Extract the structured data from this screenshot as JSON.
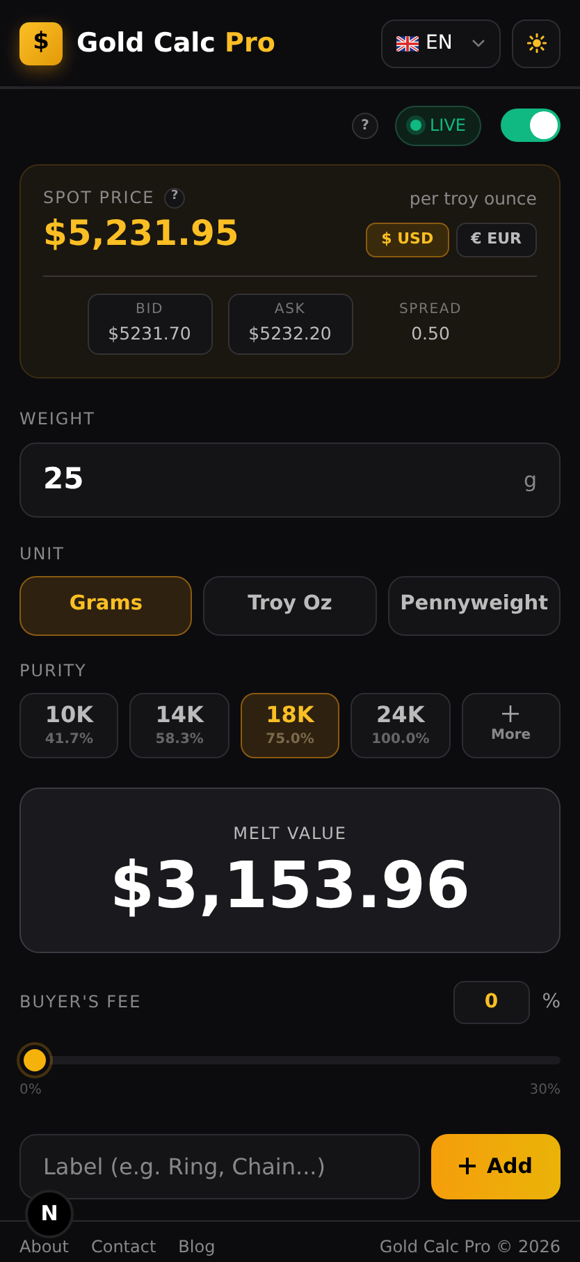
{
  "header": {
    "logo_symbol": "$",
    "title": "Gold Calc",
    "title_accent": "Pro",
    "language": "EN"
  },
  "live": {
    "help": "?",
    "label": "LIVE",
    "on": true
  },
  "spot": {
    "label": "SPOT PRICE",
    "help": "?",
    "price": "$5,231.95",
    "unit_note": "per troy ounce",
    "currencies": [
      {
        "label": "$ USD",
        "selected": true
      },
      {
        "label": "€ EUR",
        "selected": false
      }
    ],
    "quotes": [
      {
        "kind": "box",
        "label": "BID",
        "value": "$5231.70"
      },
      {
        "kind": "box",
        "label": "ASK",
        "value": "$5232.20"
      },
      {
        "kind": "plain",
        "label": "SPREAD",
        "value": "0.50"
      }
    ]
  },
  "weight": {
    "label": "WEIGHT",
    "value": "25",
    "unit": "g"
  },
  "unit": {
    "label": "UNIT",
    "options": [
      {
        "label": "Grams",
        "selected": true
      },
      {
        "label": "Troy Oz",
        "selected": false
      },
      {
        "label": "Pennyweight",
        "selected": false
      }
    ]
  },
  "purity": {
    "label": "PURITY",
    "options": [
      {
        "kind": "karat",
        "label": "10K",
        "percent": "41.7%",
        "selected": false
      },
      {
        "kind": "karat",
        "label": "14K",
        "percent": "58.3%",
        "selected": false
      },
      {
        "kind": "karat",
        "label": "18K",
        "percent": "75.0%",
        "selected": true
      },
      {
        "kind": "karat",
        "label": "24K",
        "percent": "100.0%",
        "selected": false
      },
      {
        "kind": "more",
        "label": "More",
        "selected": false
      }
    ]
  },
  "melt": {
    "label": "MELT VALUE",
    "value": "$3,153.96"
  },
  "fee": {
    "label": "BUYER'S FEE",
    "value": "0",
    "unit": "%",
    "level": 0,
    "min_label": "0%",
    "max_label": "30%"
  },
  "add": {
    "placeholder": "Label (e.g. Ring, Chain...)",
    "button": "Add"
  },
  "footer": {
    "links": [
      "About",
      "Contact",
      "Blog"
    ],
    "copyright": "Gold Calc Pro © 2026"
  },
  "dev_badge": "N"
}
